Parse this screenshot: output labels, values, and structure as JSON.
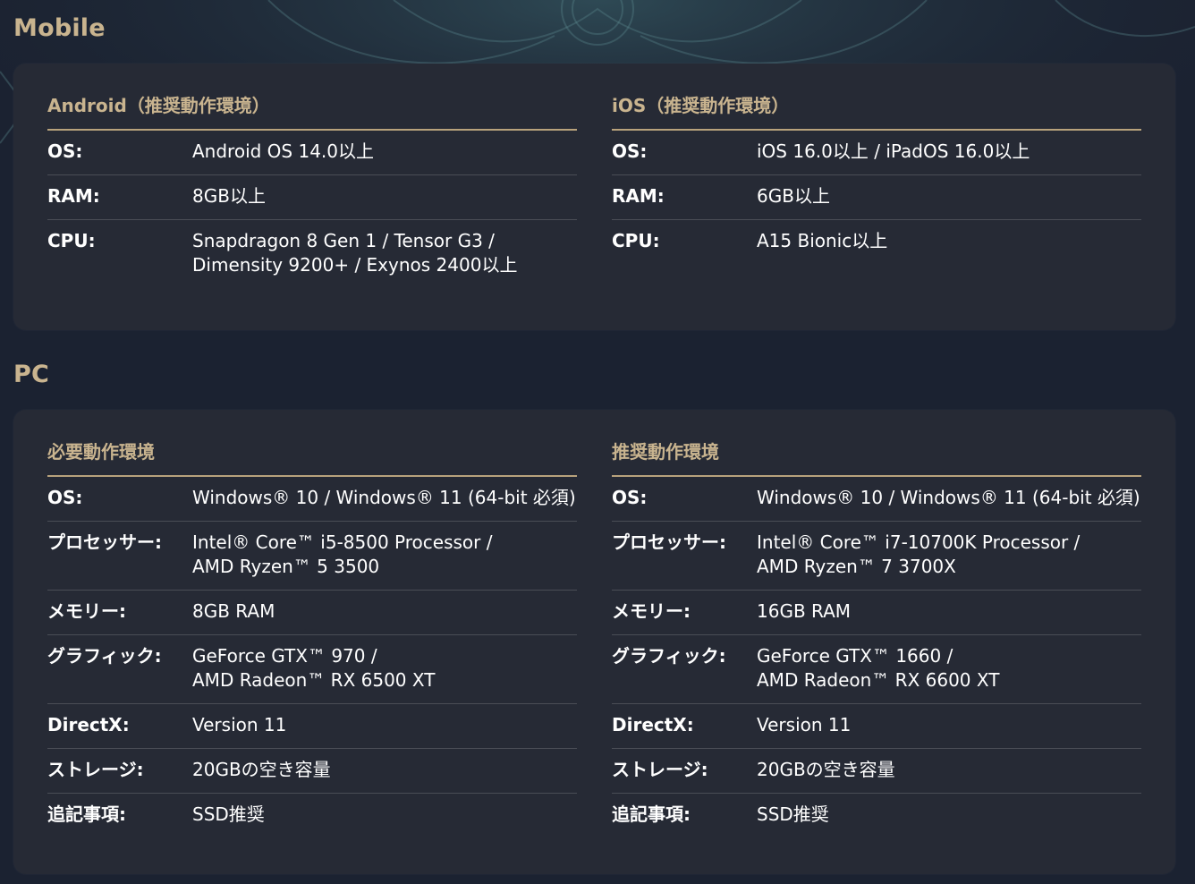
{
  "mobile": {
    "title": "Mobile",
    "android": {
      "title": "Android（推奨動作環境）",
      "rows": [
        {
          "label": "OS:",
          "value": "Android OS 14.0以上"
        },
        {
          "label": "RAM:",
          "value": "8GB以上"
        },
        {
          "label": "CPU:",
          "value": "Snapdragon 8 Gen 1 / Tensor G3 /\nDimensity 9200+ / Exynos 2400以上"
        }
      ]
    },
    "ios": {
      "title": "iOS（推奨動作環境）",
      "rows": [
        {
          "label": "OS:",
          "value": "iOS 16.0以上 / iPadOS 16.0以上"
        },
        {
          "label": "RAM:",
          "value": "6GB以上"
        },
        {
          "label": "CPU:",
          "value": "A15 Bionic以上"
        }
      ]
    }
  },
  "pc": {
    "title": "PC",
    "minimum": {
      "title": "必要動作環境",
      "rows": [
        {
          "label": "OS:",
          "value": "Windows® 10 / Windows® 11 (64-bit 必須)"
        },
        {
          "label": "プロセッサー:",
          "value": "Intel® Core™ i5-8500 Processor /\nAMD Ryzen™ 5 3500"
        },
        {
          "label": "メモリー:",
          "value": "8GB RAM"
        },
        {
          "label": "グラフィック:",
          "value": "GeForce GTX™ 970 /\nAMD Radeon™ RX 6500 XT"
        },
        {
          "label": "DirectX:",
          "value": "Version 11"
        },
        {
          "label": "ストレージ:",
          "value": "20GBの空き容量"
        },
        {
          "label": "追記事項:",
          "value": "SSD推奨"
        }
      ]
    },
    "recommended": {
      "title": "推奨動作環境",
      "rows": [
        {
          "label": "OS:",
          "value": "Windows® 10 / Windows® 11 (64-bit 必須)"
        },
        {
          "label": "プロセッサー:",
          "value": "Intel® Core™ i7-10700K Processor /\nAMD Ryzen™ 7 3700X"
        },
        {
          "label": "メモリー:",
          "value": "16GB RAM"
        },
        {
          "label": "グラフィック:",
          "value": "GeForce GTX™ 1660 /\nAMD Radeon™ RX 6600 XT"
        },
        {
          "label": "DirectX:",
          "value": "Version 11"
        },
        {
          "label": "ストレージ:",
          "value": "20GBの空き容量"
        },
        {
          "label": "追記事項:",
          "value": "SSD推奨"
        }
      ]
    }
  }
}
